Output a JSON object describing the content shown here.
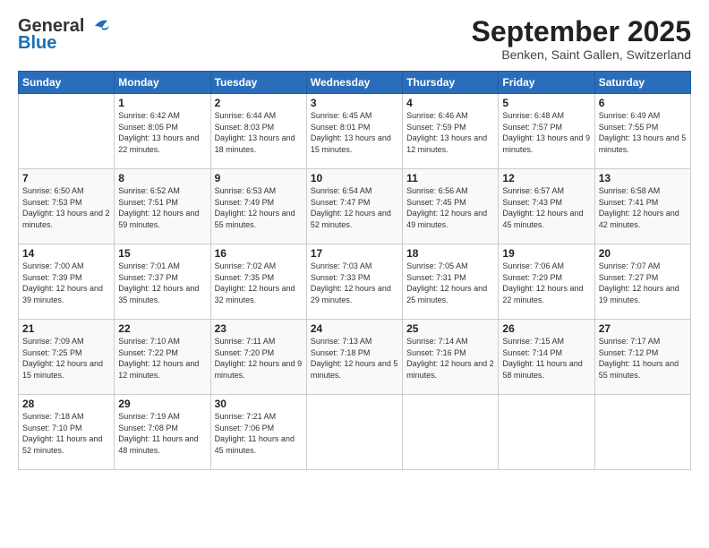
{
  "header": {
    "logo_general": "General",
    "logo_blue": "Blue",
    "month": "September 2025",
    "location": "Benken, Saint Gallen, Switzerland"
  },
  "days_of_week": [
    "Sunday",
    "Monday",
    "Tuesday",
    "Wednesday",
    "Thursday",
    "Friday",
    "Saturday"
  ],
  "weeks": [
    [
      {
        "day": "",
        "sunrise": "",
        "sunset": "",
        "daylight": ""
      },
      {
        "day": "1",
        "sunrise": "Sunrise: 6:42 AM",
        "sunset": "Sunset: 8:05 PM",
        "daylight": "Daylight: 13 hours and 22 minutes."
      },
      {
        "day": "2",
        "sunrise": "Sunrise: 6:44 AM",
        "sunset": "Sunset: 8:03 PM",
        "daylight": "Daylight: 13 hours and 18 minutes."
      },
      {
        "day": "3",
        "sunrise": "Sunrise: 6:45 AM",
        "sunset": "Sunset: 8:01 PM",
        "daylight": "Daylight: 13 hours and 15 minutes."
      },
      {
        "day": "4",
        "sunrise": "Sunrise: 6:46 AM",
        "sunset": "Sunset: 7:59 PM",
        "daylight": "Daylight: 13 hours and 12 minutes."
      },
      {
        "day": "5",
        "sunrise": "Sunrise: 6:48 AM",
        "sunset": "Sunset: 7:57 PM",
        "daylight": "Daylight: 13 hours and 9 minutes."
      },
      {
        "day": "6",
        "sunrise": "Sunrise: 6:49 AM",
        "sunset": "Sunset: 7:55 PM",
        "daylight": "Daylight: 13 hours and 5 minutes."
      }
    ],
    [
      {
        "day": "7",
        "sunrise": "Sunrise: 6:50 AM",
        "sunset": "Sunset: 7:53 PM",
        "daylight": "Daylight: 13 hours and 2 minutes."
      },
      {
        "day": "8",
        "sunrise": "Sunrise: 6:52 AM",
        "sunset": "Sunset: 7:51 PM",
        "daylight": "Daylight: 12 hours and 59 minutes."
      },
      {
        "day": "9",
        "sunrise": "Sunrise: 6:53 AM",
        "sunset": "Sunset: 7:49 PM",
        "daylight": "Daylight: 12 hours and 55 minutes."
      },
      {
        "day": "10",
        "sunrise": "Sunrise: 6:54 AM",
        "sunset": "Sunset: 7:47 PM",
        "daylight": "Daylight: 12 hours and 52 minutes."
      },
      {
        "day": "11",
        "sunrise": "Sunrise: 6:56 AM",
        "sunset": "Sunset: 7:45 PM",
        "daylight": "Daylight: 12 hours and 49 minutes."
      },
      {
        "day": "12",
        "sunrise": "Sunrise: 6:57 AM",
        "sunset": "Sunset: 7:43 PM",
        "daylight": "Daylight: 12 hours and 45 minutes."
      },
      {
        "day": "13",
        "sunrise": "Sunrise: 6:58 AM",
        "sunset": "Sunset: 7:41 PM",
        "daylight": "Daylight: 12 hours and 42 minutes."
      }
    ],
    [
      {
        "day": "14",
        "sunrise": "Sunrise: 7:00 AM",
        "sunset": "Sunset: 7:39 PM",
        "daylight": "Daylight: 12 hours and 39 minutes."
      },
      {
        "day": "15",
        "sunrise": "Sunrise: 7:01 AM",
        "sunset": "Sunset: 7:37 PM",
        "daylight": "Daylight: 12 hours and 35 minutes."
      },
      {
        "day": "16",
        "sunrise": "Sunrise: 7:02 AM",
        "sunset": "Sunset: 7:35 PM",
        "daylight": "Daylight: 12 hours and 32 minutes."
      },
      {
        "day": "17",
        "sunrise": "Sunrise: 7:03 AM",
        "sunset": "Sunset: 7:33 PM",
        "daylight": "Daylight: 12 hours and 29 minutes."
      },
      {
        "day": "18",
        "sunrise": "Sunrise: 7:05 AM",
        "sunset": "Sunset: 7:31 PM",
        "daylight": "Daylight: 12 hours and 25 minutes."
      },
      {
        "day": "19",
        "sunrise": "Sunrise: 7:06 AM",
        "sunset": "Sunset: 7:29 PM",
        "daylight": "Daylight: 12 hours and 22 minutes."
      },
      {
        "day": "20",
        "sunrise": "Sunrise: 7:07 AM",
        "sunset": "Sunset: 7:27 PM",
        "daylight": "Daylight: 12 hours and 19 minutes."
      }
    ],
    [
      {
        "day": "21",
        "sunrise": "Sunrise: 7:09 AM",
        "sunset": "Sunset: 7:25 PM",
        "daylight": "Daylight: 12 hours and 15 minutes."
      },
      {
        "day": "22",
        "sunrise": "Sunrise: 7:10 AM",
        "sunset": "Sunset: 7:22 PM",
        "daylight": "Daylight: 12 hours and 12 minutes."
      },
      {
        "day": "23",
        "sunrise": "Sunrise: 7:11 AM",
        "sunset": "Sunset: 7:20 PM",
        "daylight": "Daylight: 12 hours and 9 minutes."
      },
      {
        "day": "24",
        "sunrise": "Sunrise: 7:13 AM",
        "sunset": "Sunset: 7:18 PM",
        "daylight": "Daylight: 12 hours and 5 minutes."
      },
      {
        "day": "25",
        "sunrise": "Sunrise: 7:14 AM",
        "sunset": "Sunset: 7:16 PM",
        "daylight": "Daylight: 12 hours and 2 minutes."
      },
      {
        "day": "26",
        "sunrise": "Sunrise: 7:15 AM",
        "sunset": "Sunset: 7:14 PM",
        "daylight": "Daylight: 11 hours and 58 minutes."
      },
      {
        "day": "27",
        "sunrise": "Sunrise: 7:17 AM",
        "sunset": "Sunset: 7:12 PM",
        "daylight": "Daylight: 11 hours and 55 minutes."
      }
    ],
    [
      {
        "day": "28",
        "sunrise": "Sunrise: 7:18 AM",
        "sunset": "Sunset: 7:10 PM",
        "daylight": "Daylight: 11 hours and 52 minutes."
      },
      {
        "day": "29",
        "sunrise": "Sunrise: 7:19 AM",
        "sunset": "Sunset: 7:08 PM",
        "daylight": "Daylight: 11 hours and 48 minutes."
      },
      {
        "day": "30",
        "sunrise": "Sunrise: 7:21 AM",
        "sunset": "Sunset: 7:06 PM",
        "daylight": "Daylight: 11 hours and 45 minutes."
      },
      {
        "day": "",
        "sunrise": "",
        "sunset": "",
        "daylight": ""
      },
      {
        "day": "",
        "sunrise": "",
        "sunset": "",
        "daylight": ""
      },
      {
        "day": "",
        "sunrise": "",
        "sunset": "",
        "daylight": ""
      },
      {
        "day": "",
        "sunrise": "",
        "sunset": "",
        "daylight": ""
      }
    ]
  ]
}
